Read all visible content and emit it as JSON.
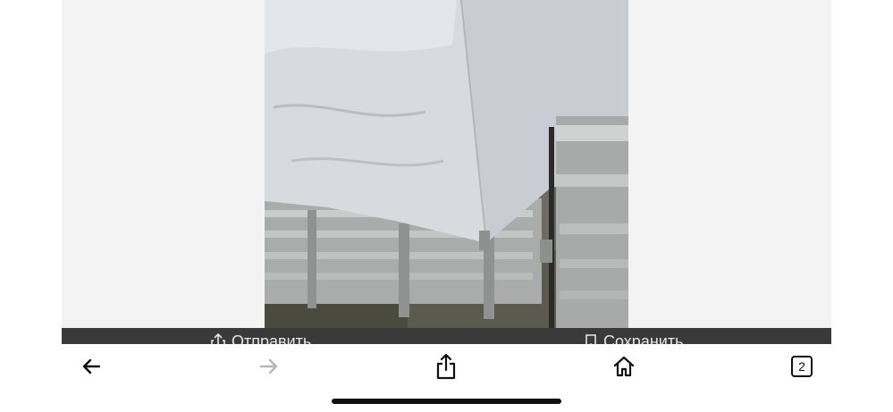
{
  "photo": {
    "alt_subject": "trailer-with-tarp-cover"
  },
  "actions": {
    "send_label": "Отправить",
    "save_label": "Сохранить"
  },
  "toolbar": {
    "back_icon": "arrow-left-icon",
    "forward_icon": "arrow-right-icon",
    "share_icon": "share-icon",
    "home_icon": "home-icon",
    "tabs_count": "2"
  },
  "colors": {
    "action_bar": "#3a3a3a",
    "forward_disabled": "#b5b5b5",
    "icon": "#111111"
  }
}
